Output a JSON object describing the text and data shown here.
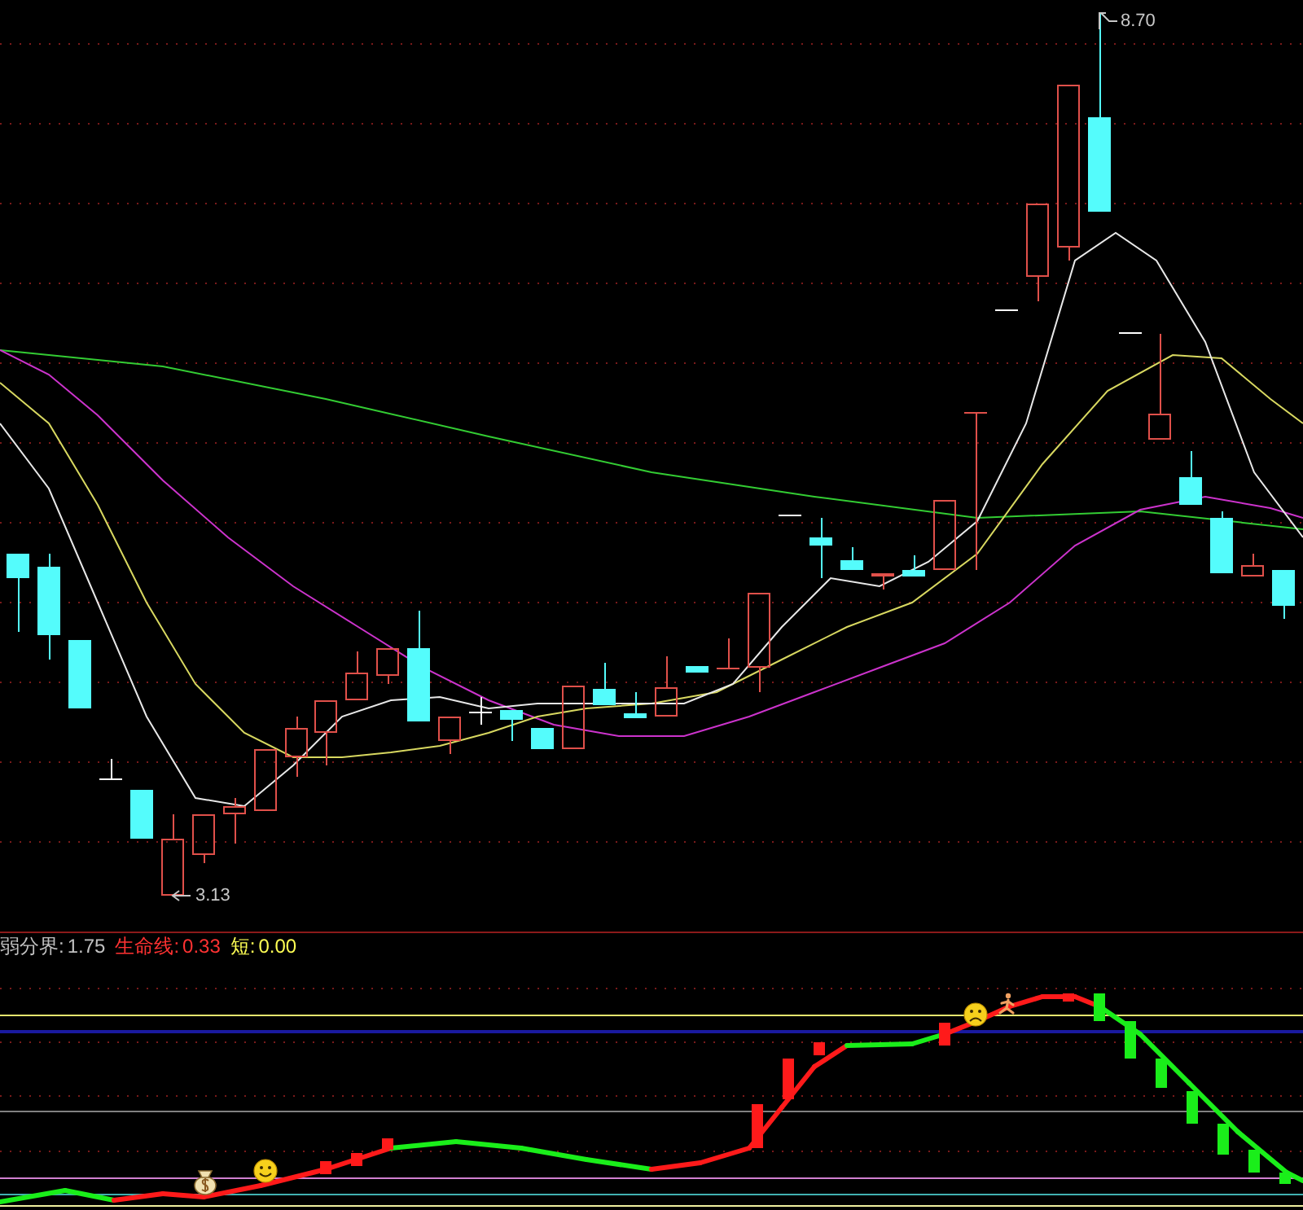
{
  "price_chart": {
    "high_label": "8.70",
    "low_label": "3.13"
  },
  "indicator_legend": [
    {
      "label": "弱分界:",
      "value": "1.75",
      "color": "#c0c0c0"
    },
    {
      "label": "生命线:",
      "value": "0.33",
      "color": "#ff3232"
    },
    {
      "label": "短:",
      "value": "0.00",
      "color": "#ffff54"
    }
  ]
}
